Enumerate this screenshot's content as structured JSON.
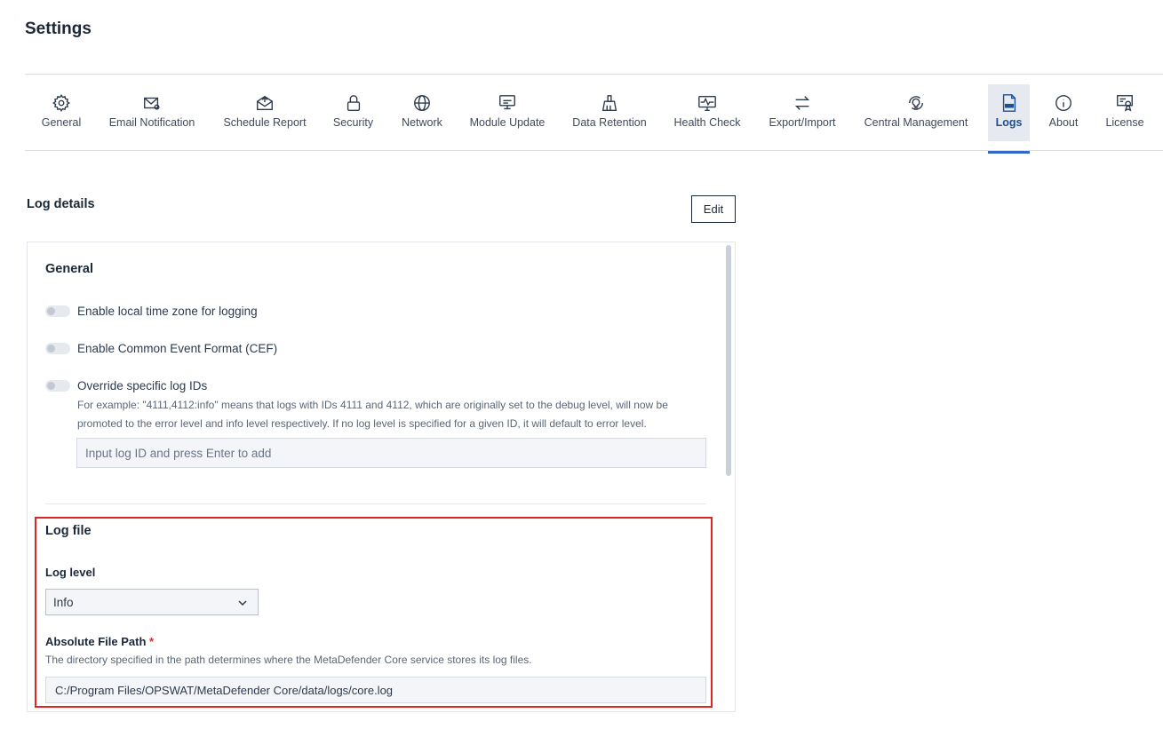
{
  "page": {
    "title": "Settings"
  },
  "tabs": [
    {
      "label": "General",
      "icon": "gear-icon"
    },
    {
      "label": "Email Notification",
      "icon": "envelope-icon"
    },
    {
      "label": "Schedule Report",
      "icon": "mail-open-icon"
    },
    {
      "label": "Security",
      "icon": "lock-icon"
    },
    {
      "label": "Network",
      "icon": "globe-icon"
    },
    {
      "label": "Module Update",
      "icon": "monitor-icon"
    },
    {
      "label": "Data Retention",
      "icon": "broom-icon"
    },
    {
      "label": "Health Check",
      "icon": "pulse-monitor-icon"
    },
    {
      "label": "Export/Import",
      "icon": "swap-arrows-icon"
    },
    {
      "label": "Central Management",
      "icon": "lightbulb-cycle-icon"
    },
    {
      "label": "Logs",
      "icon": "log-file-icon",
      "active": true
    },
    {
      "label": "About",
      "icon": "info-icon"
    },
    {
      "label": "License",
      "icon": "certificate-icon"
    }
  ],
  "log_details": {
    "title": "Log details",
    "edit_label": "Edit",
    "general": {
      "title": "General",
      "toggles": [
        {
          "label": "Enable local time zone for logging",
          "on": false
        },
        {
          "label": "Enable Common Event Format (CEF)",
          "on": false
        },
        {
          "label": "Override specific log IDs",
          "on": false
        }
      ],
      "override_help": "For example: \"4111,4112:info\" means that logs with IDs 4111 and 4112, which are originally set to the debug level, will now be promoted to the error level and info level respectively. If no log level is specified for a given ID, it will default to error level.",
      "log_id_placeholder": "Input log ID and press Enter to add"
    },
    "log_file": {
      "title": "Log file",
      "log_level_label": "Log level",
      "log_level_value": "Info",
      "path_label": "Absolute File Path",
      "path_required_mark": "*",
      "path_help": "The directory specified in the path determines where the MetaDefender Core service stores its log files.",
      "path_value": "C:/Program Files/OPSWAT/MetaDefender Core/data/logs/core.log"
    }
  },
  "colors": {
    "accent": "#3567c9",
    "highlight": "#e02424",
    "text": "#1b2838"
  }
}
